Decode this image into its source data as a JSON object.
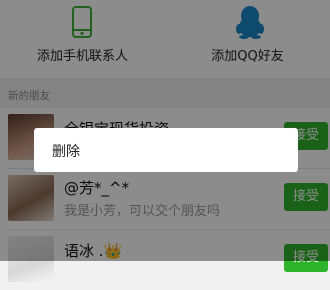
{
  "header": {
    "add_phone_contacts": "添加手机联系人",
    "add_qq_friends": "添加QQ好友"
  },
  "section": {
    "title": "新的朋友"
  },
  "requests": [
    {
      "name": "全银宝现货投资",
      "message": "",
      "action": "接受"
    },
    {
      "name": "@芳*_^*",
      "message": "我是小芳，可以交个朋友吗",
      "action": "接受"
    },
    {
      "name": "语冰 .👑",
      "message": "",
      "action": "接受"
    }
  ],
  "context_menu": {
    "delete_label": "删除"
  },
  "colors": {
    "accept_green": "#2eb32b",
    "phone_icon_green": "#3cb035",
    "qq_icon_blue": "#1b86c9"
  },
  "icons": [
    "phone-icon",
    "qq-penguin-icon"
  ]
}
